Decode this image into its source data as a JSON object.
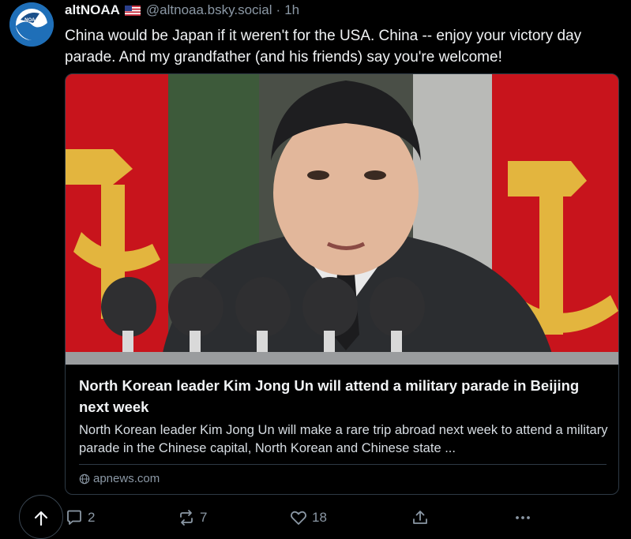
{
  "author": {
    "display_name": "altNOAA",
    "flag": "🇺🇸",
    "handle": "@altnoaa.bsky.social",
    "separator": "·",
    "time": "1h",
    "avatar_text": "NOAA"
  },
  "post": {
    "text": "China would be Japan if it weren't for the USA. China -- enjoy your victory day parade. And my grandfather (and his friends) say you're welcome!"
  },
  "link_card": {
    "image_icon": "news-photo",
    "title": "North Korean leader Kim Jong Un will attend a military parade in Beijing next week",
    "description": "North Korean leader Kim Jong Un will make a rare trip abroad next week to attend a military parade in the Chinese capital, North Korean and Chinese state ...",
    "domain": "apnews.com",
    "domain_icon": "globe-icon"
  },
  "actions": {
    "scroll_top_icon": "arrow-up-icon",
    "reply_count": "2",
    "repost_count": "7",
    "like_count": "18",
    "share_icon": "share-icon",
    "more_icon": "ellipsis-icon"
  },
  "colors": {
    "background": "#000000",
    "text": "#f1f3f5",
    "muted": "#8b98a5",
    "border": "#2e3a45",
    "avatar": "#1f6fb8"
  }
}
